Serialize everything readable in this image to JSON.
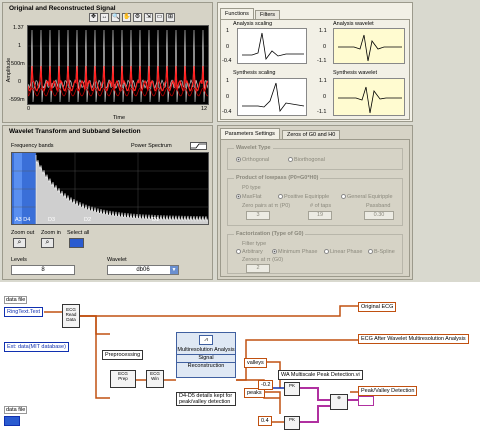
{
  "signal_panel": {
    "title": "Original and Reconstructed Signal",
    "y_axis_label": "Amplitude",
    "x_axis_label": "Time",
    "y_ticks": [
      "1.37",
      "1",
      "500m",
      "0",
      "-599m"
    ],
    "x_ticks": [
      "0",
      "12"
    ],
    "toolbar_icons": [
      "✥",
      "↔",
      "🔍",
      "✋",
      "⚙",
      "⇲",
      "▭",
      "⊞"
    ]
  },
  "wavelet_panel": {
    "title": "Wavelet Transform and Subband Selection",
    "freq_label": "Frequency bands",
    "power_label": "Power Spectrum",
    "band_labels": [
      "A3 D4",
      "D3",
      "D2",
      "D1"
    ],
    "zoom_out_label": "Zoom out",
    "zoom_in_label": "Zoom in",
    "select_all_label": "Select all",
    "levels_label": "Levels",
    "levels_value": "8",
    "wavelet_label": "Wavelet",
    "wavelet_value": "db06"
  },
  "functions_panel": {
    "tabs": [
      "Functions",
      "Filters"
    ],
    "analysis_scaling": {
      "title": "Analysis scaling",
      "ticks": [
        "1",
        "0",
        "-0.4"
      ]
    },
    "analysis_wavelet": {
      "title": "Analysis wavelet",
      "ticks": [
        "1.1",
        "0",
        "-1.1"
      ]
    },
    "synthesis_scaling": {
      "title": "Synthesis scaling",
      "ticks": [
        "1",
        "0",
        "-0.4"
      ]
    },
    "synthesis_wavelet": {
      "title": "Synthesis wavelet",
      "ticks": [
        "1.1",
        "0",
        "-1.1"
      ]
    }
  },
  "params_panel": {
    "tabs": [
      "Parameters Settings",
      "Zeros of G0 and H0"
    ],
    "wavelet_type": {
      "title": "Wavelet Type",
      "options": [
        "Orthogonal",
        "Biorthogonal"
      ]
    },
    "product": {
      "title": "Product of lowpass (P0=G0*H0)",
      "p0_type": "P0 type",
      "options": [
        "MaxFlat",
        "Positive Equiripple",
        "General Equiripple"
      ],
      "zero_pairs_label": "Zero pairs at π (P0)",
      "zero_pairs_value": "3",
      "taps_label": "# of taps",
      "taps_value": "19",
      "passband_label": "Passband",
      "passband_value": "0.30"
    },
    "factorization": {
      "title": "Factorization (Type of G0)",
      "filter_type": "Filter type",
      "options": [
        "Arbitrary",
        "Minimum Phase",
        "Linear Phase",
        "B-Spline"
      ],
      "zeroes_label": "Zeroes at π (G0)",
      "zeroes_value": "2"
    }
  },
  "block_diagram": {
    "data_file_top": "data file",
    "ringtext": "RingText.Text",
    "ecg_read": "ECG Read Data",
    "ext_data": "Ext: data(MIT database)",
    "preprocessing": "Preprocessing",
    "multires_title": "Multiresolution Analysis",
    "signal_label": "Signal",
    "reconstruction_label": "Reconstruction",
    "note": "D4-D5 details kept for peak/valley detection",
    "valleys": "valleys",
    "peaks": "peaks",
    "neg02": "-0.2",
    "pos04": "0.4",
    "ma_label": "WA Multiscale Peak Detection.vi",
    "original_ecg": "Original ECG",
    "ecg_after": "ECG After Wavelet Multiresolution Analysis",
    "peak_valley": "Peak/Valley Detection",
    "data_file_bottom": "data file"
  }
}
